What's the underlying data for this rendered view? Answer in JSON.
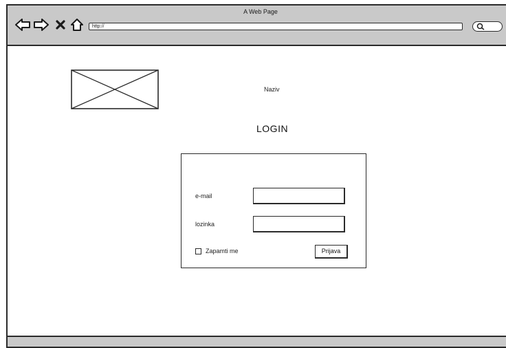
{
  "window": {
    "title": "A Web Page"
  },
  "toolbar": {
    "back_icon": "back-arrow-icon",
    "forward_icon": "forward-arrow-icon",
    "stop_icon": "close-icon",
    "home_icon": "home-icon",
    "search_icon": "search-icon"
  },
  "address_bar": {
    "url": "http://"
  },
  "page": {
    "logo_icon": "image-placeholder-icon",
    "site_name": "Naziv",
    "login_title": "LOGIN"
  },
  "login_form": {
    "email_label": "e-mail",
    "email_value": "",
    "password_label": "lozinka",
    "password_value": "",
    "remember_label": "Zapamti me",
    "remember_checked": false,
    "submit_label": "Prijava"
  }
}
